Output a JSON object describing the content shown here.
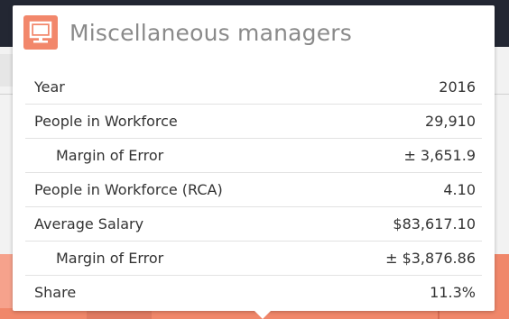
{
  "tooltip": {
    "icon": "computer-monitor-icon",
    "title": "Miscellaneous managers",
    "rows": [
      {
        "label": "Year",
        "value": "2016"
      },
      {
        "label": "People in Workforce",
        "value": "29,910"
      },
      {
        "label": "Margin of Error",
        "value": "± 3,651.9"
      },
      {
        "label": "People in Workforce (RCA)",
        "value": "4.10"
      },
      {
        "label": "Average Salary",
        "value": "$83,617.10"
      },
      {
        "label": "Margin of Error",
        "value": "± $3,876.86"
      },
      {
        "label": "Share",
        "value": "11.3%"
      }
    ]
  },
  "colors": {
    "accent": "#f2876b",
    "background_bar": "#f0876a",
    "topbar": "#232733"
  }
}
